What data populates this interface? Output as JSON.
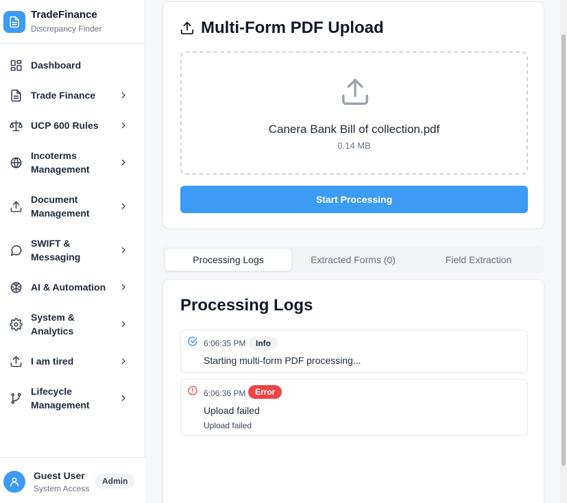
{
  "brand": {
    "title": "TradeFinance",
    "subtitle": "Discrepancy Finder"
  },
  "sidebar": {
    "items": [
      {
        "label": "Dashboard",
        "icon": "dashboard-icon"
      },
      {
        "label": "Trade Finance",
        "icon": "document-icon"
      },
      {
        "label": "UCP 600 Rules",
        "icon": "scale-icon"
      },
      {
        "label": "Incoterms Management",
        "icon": "globe-icon"
      },
      {
        "label": "Document Management",
        "icon": "upload-icon"
      },
      {
        "label": "SWIFT & Messaging",
        "icon": "message-icon"
      },
      {
        "label": "AI & Automation",
        "icon": "brain-icon"
      },
      {
        "label": "System & Analytics",
        "icon": "gear-icon"
      },
      {
        "label": "I am tired",
        "icon": "upload-icon"
      },
      {
        "label": "Lifecycle Management",
        "icon": "git-branch-icon"
      }
    ]
  },
  "user": {
    "name": "Guest User",
    "role": "System Access",
    "badge": "Admin"
  },
  "upload": {
    "title": "Multi-Form PDF Upload",
    "file_name": "Canera Bank Bill of collection.pdf",
    "file_size": "0.14 MB",
    "button_label": "Start Processing"
  },
  "tabs": [
    {
      "label": "Processing Logs",
      "active": true
    },
    {
      "label": "Extracted Forms (0)",
      "active": false
    },
    {
      "label": "Field Extraction",
      "active": false
    }
  ],
  "logs": {
    "title": "Processing Logs",
    "entries": [
      {
        "time": "6:06:35 PM",
        "level": "Info",
        "message": "Starting multi-form PDF processing..."
      },
      {
        "time": "6:06:36 PM",
        "level": "Error",
        "message": "Upload failed",
        "detail": "Upload failed"
      }
    ]
  },
  "colors": {
    "accent": "#3b9bf5",
    "error": "#ef4444"
  }
}
